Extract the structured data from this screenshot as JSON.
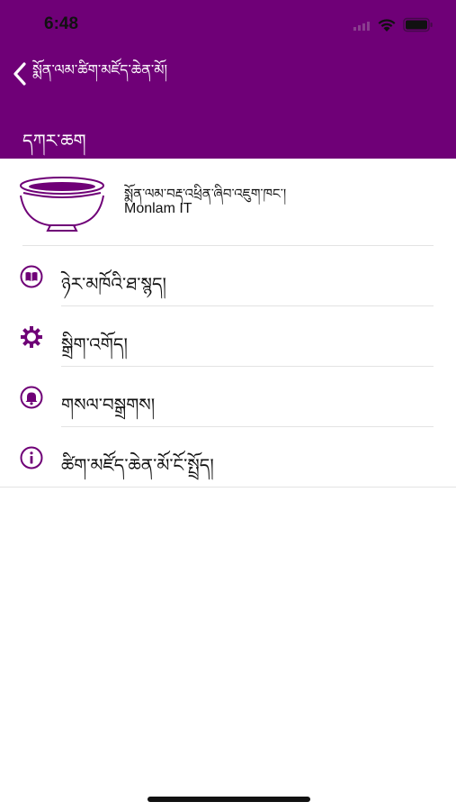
{
  "status_bar": {
    "time": "6:48"
  },
  "nav": {
    "back_label": "སྨོན་ལམ་ཚིག་མཛོད་ཆེན་མོ།"
  },
  "header": {
    "title": "དཀར་ཆག"
  },
  "brand": {
    "tibetan_name": "སྨོན་ལམ་བརྡ་འཕྲིན་ཞིབ་འཇུག་ཁང་།",
    "name": "Monlam IT"
  },
  "menu": {
    "items": [
      {
        "label": "ཉེར་མཁོའི་ཐ་སྙད།",
        "icon": "book-icon"
      },
      {
        "label": "སྒྲིག་འགོད།",
        "icon": "gear-icon"
      },
      {
        "label": "གསལ་བསྒྲགས།",
        "icon": "bell-icon"
      },
      {
        "label": "ཚིག་མཛོད་ཆེན་མོ་ངོ་སྤྲོད།",
        "icon": "info-icon"
      }
    ]
  },
  "colors": {
    "accent": "#6f0077",
    "background": "#ffffff",
    "divider": "#e3e3e3"
  }
}
